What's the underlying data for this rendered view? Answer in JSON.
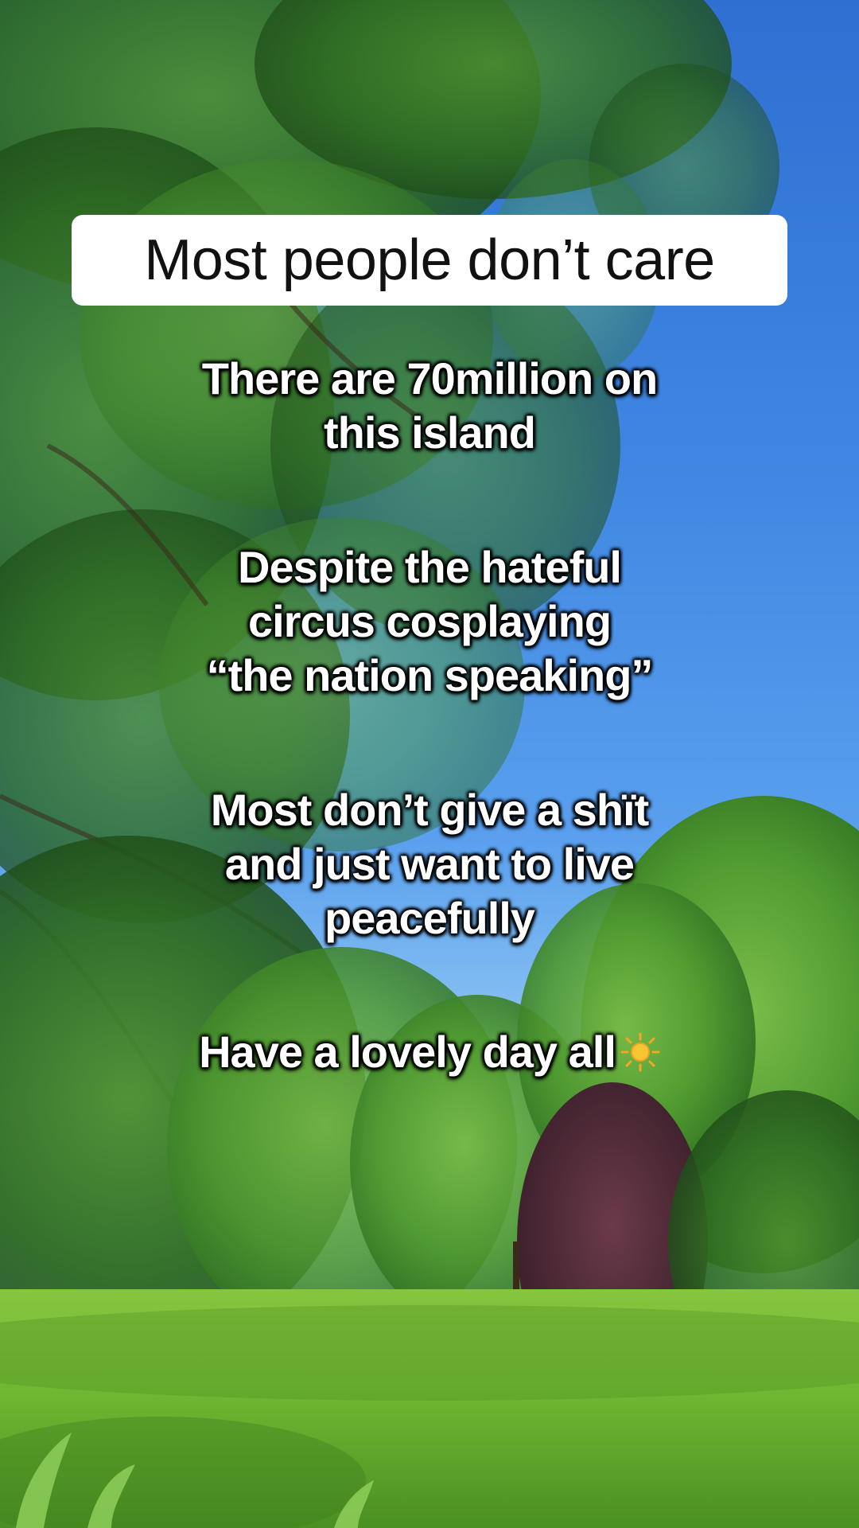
{
  "title": "Most people don’t care",
  "captions": {
    "line1": "There are 70million on\nthis island",
    "line2": "Despite the hateful\ncircus cosplaying\n“the nation speaking”",
    "line3": "Most don’t give a shït\nand just want to live\npeacefully",
    "line4": "Have a lovely day all"
  },
  "icons": {
    "closing": "sun-icon"
  },
  "colors": {
    "sky": "#3f86e2",
    "foliage": "#2f6a25",
    "grass": "#7fc23a",
    "title_box": "#ffffff"
  }
}
